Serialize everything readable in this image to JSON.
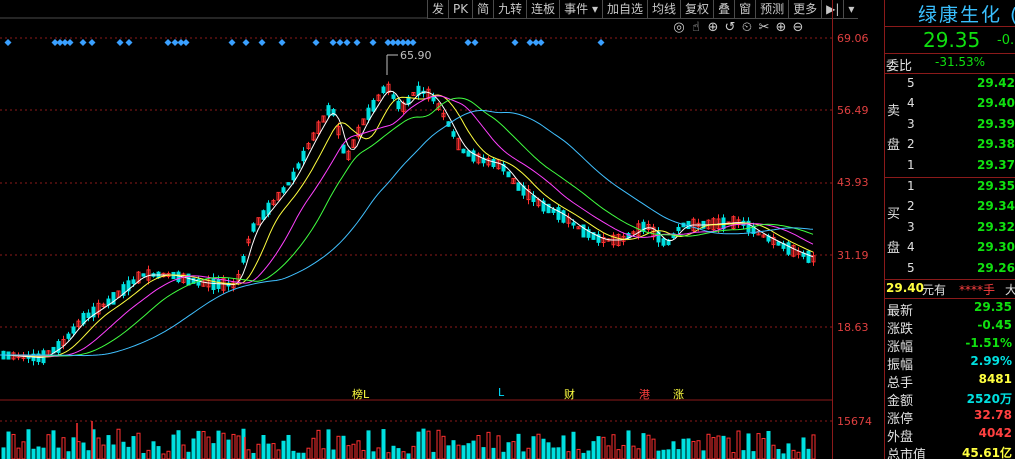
{
  "toolbar": {
    "items": [
      "发",
      "PK",
      "简",
      "九转",
      "连板",
      "事件 ▾",
      "加自选",
      "均线",
      "复权",
      "叠",
      "窗",
      "预测",
      "更多",
      "▶|",
      "▾"
    ]
  },
  "chart_icons": [
    "◎",
    "☝",
    "⊕",
    "↺",
    "⏲",
    "✂",
    "⊕",
    "⊖"
  ],
  "price_axis": [
    "69.06",
    "56.49",
    "43.93",
    "31.19",
    "18.63"
  ],
  "volume_axis": "15674",
  "peak_label": "65.90",
  "signals": [
    {
      "text": "榜L",
      "color": "#ffff40"
    },
    {
      "text": "L",
      "color": "#00e0ff"
    },
    {
      "text": "财",
      "color": "#ffff40"
    },
    {
      "text": "港",
      "color": "#ff4040"
    },
    {
      "text": "涨",
      "color": "#ffff40"
    }
  ],
  "stock": {
    "name": "绿康生化 (",
    "price": "29.35",
    "change": "-0.",
    "weibi_label": "委比",
    "weibi_value": "-31.53%",
    "sell_label_1": "卖",
    "sell_label_2": "盘",
    "buy_label_1": "买",
    "buy_label_2": "盘",
    "sell": [
      {
        "level": "5",
        "price": "29.42"
      },
      {
        "level": "4",
        "price": "29.40"
      },
      {
        "level": "3",
        "price": "29.39"
      },
      {
        "level": "2",
        "price": "29.38"
      },
      {
        "level": "1",
        "price": "29.37"
      }
    ],
    "buy": [
      {
        "level": "1",
        "price": "29.35"
      },
      {
        "level": "2",
        "price": "29.34"
      },
      {
        "level": "3",
        "price": "29.32"
      },
      {
        "level": "4",
        "price": "29.30"
      },
      {
        "level": "5",
        "price": "29.26"
      }
    ],
    "order_price": "29.40",
    "order_text": "元有",
    "order_stars": "****手",
    "order_tail": "大",
    "stats": [
      {
        "label": "最新",
        "value": "29.35",
        "color": "green"
      },
      {
        "label": "涨跌",
        "value": "-0.45",
        "color": "green"
      },
      {
        "label": "涨幅",
        "value": "-1.51%",
        "color": "green"
      },
      {
        "label": "振幅",
        "value": "2.99%",
        "color": "cyan"
      },
      {
        "label": "总手",
        "value": "8481",
        "color": "yellow"
      },
      {
        "label": "金额",
        "value": "2520万",
        "color": "cyan"
      },
      {
        "label": "涨停",
        "value": "32.78",
        "color": "red"
      },
      {
        "label": "外盘",
        "value": "4042",
        "color": "red"
      },
      {
        "label": "总市值",
        "value": "45.61亿",
        "color": "yellow"
      }
    ]
  },
  "colors": {
    "up": "#ff3030",
    "down": "#00e0e0",
    "ma5": "#ffffff",
    "ma10": "#ffff40",
    "ma20": "#ff40ff",
    "ma30": "#40ff40",
    "ma60": "#40c0ff",
    "grid": "#8b1a1a"
  }
}
